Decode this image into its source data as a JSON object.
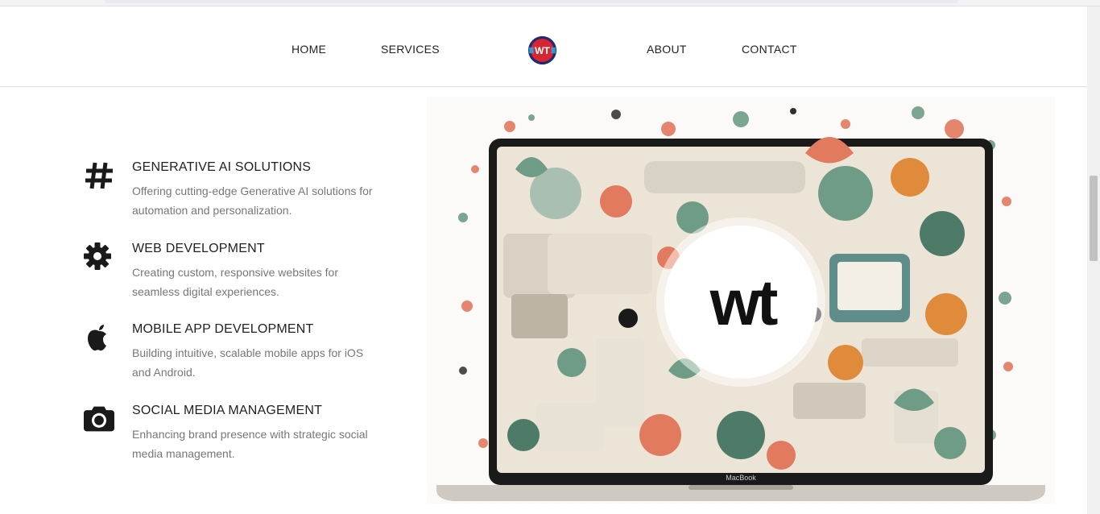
{
  "nav": {
    "home": "HOME",
    "services": "SERVICES",
    "about": "ABOUT",
    "contact": "CONTACT",
    "logo_text": "WT",
    "logo_colors": {
      "ring": "#1f2b6e",
      "inner": "#d72631",
      "accent": "#2aa9e0"
    }
  },
  "services": [
    {
      "icon": "hashtag-icon",
      "title": "GENERATIVE AI SOLUTIONS",
      "desc": "Offering cutting-edge Generative AI solutions for automation and personalization."
    },
    {
      "icon": "gear-icon",
      "title": "WEB DEVELOPMENT",
      "desc": "Creating custom, responsive websites for seamless digital experiences."
    },
    {
      "icon": "apple-icon",
      "title": "MOBILE APP DEVELOPMENT",
      "desc": "Building intuitive, scalable mobile apps for iOS and Android."
    },
    {
      "icon": "camera-icon",
      "title": "SOCIAL MEDIA MANAGEMENT",
      "desc": "Enhancing brand presence with strategic social media management."
    }
  ],
  "hero": {
    "screen_text": "wt",
    "laptop_label": "MacBook",
    "colors": {
      "green": "#6f9c86",
      "coral": "#e27a5f",
      "cream": "#ece4d6",
      "dark": "#1a1a1a",
      "orange": "#e08a3c"
    }
  }
}
